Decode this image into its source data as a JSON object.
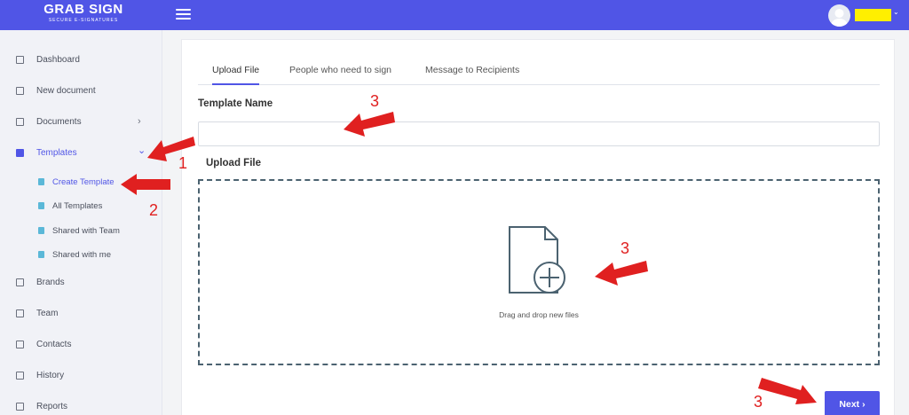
{
  "header": {
    "logo_main": "GRAB SIGN",
    "logo_sub": "SECURE E-SIGNATURES",
    "menu_icon": "hamburger-icon",
    "user_icon": "user-avatar-icon",
    "accent_color": "#5055e6"
  },
  "sidebar": {
    "items": [
      {
        "label": "Dashboard",
        "icon": "dashboard-icon"
      },
      {
        "label": "New document",
        "icon": "document-icon"
      },
      {
        "label": "Documents",
        "icon": "documents-icon",
        "chevron": "›"
      },
      {
        "label": "Templates",
        "icon": "templates-icon",
        "chevron": "⌄"
      },
      {
        "label": "Brands",
        "icon": "brands-icon"
      },
      {
        "label": "Team",
        "icon": "team-icon"
      },
      {
        "label": "Contacts",
        "icon": "contacts-icon"
      },
      {
        "label": "History",
        "icon": "history-icon"
      },
      {
        "label": "Reports",
        "icon": "reports-icon"
      }
    ],
    "template_subitems": [
      {
        "label": "Create Template"
      },
      {
        "label": "All Templates"
      },
      {
        "label": "Shared with Team"
      },
      {
        "label": "Shared with me"
      }
    ]
  },
  "main": {
    "tabs": [
      {
        "label": "Upload File"
      },
      {
        "label": "People who need to sign"
      },
      {
        "label": "Message to Recipients"
      }
    ],
    "template_name_label": "Template Name",
    "template_name_value": "",
    "upload_label": "Upload File",
    "dropzone_text": "Drag and drop new files",
    "dropzone_icon": "file-add-icon",
    "next_label": "Next ›"
  },
  "annotations": {
    "color": "#e02020",
    "n1": "1",
    "n2": "2",
    "n3a": "3",
    "n3b": "3",
    "n3c": "3"
  }
}
